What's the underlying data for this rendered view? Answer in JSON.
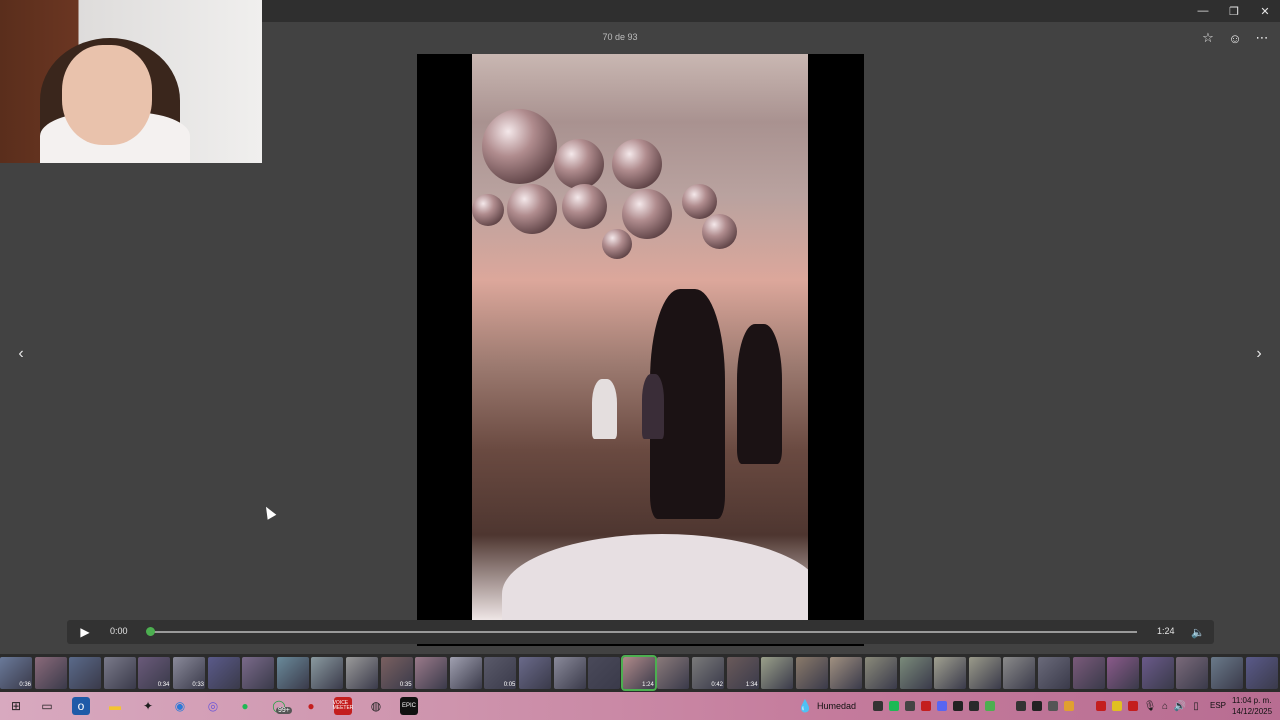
{
  "app": {
    "counter_text": "70 de 93"
  },
  "toolbar": {
    "favorite_icon": "star-icon",
    "reaction_icon": "smiley-icon",
    "more_icon": "more-icon"
  },
  "window_controls": {
    "minimize_icon": "minimize-icon",
    "restore_icon": "restore-icon",
    "close_icon": "close-icon"
  },
  "player": {
    "current_time": "0:00",
    "duration": "1:24",
    "progress_fraction": 0.0,
    "accent_color": "#4caf50"
  },
  "filmstrip": {
    "durations": [
      "0:36",
      "0:34",
      "0:33",
      "0:35",
      "0:05",
      "1:24",
      "0:42",
      "1:34"
    ]
  },
  "taskbar": {
    "weather_label": "Humedad",
    "chat_badge": "99+",
    "language": "ESP",
    "time": "11:04 p. m.",
    "date": "14/12/2025",
    "vote_label": "VOICE\nMEETER",
    "epic_label": "EPIC"
  }
}
